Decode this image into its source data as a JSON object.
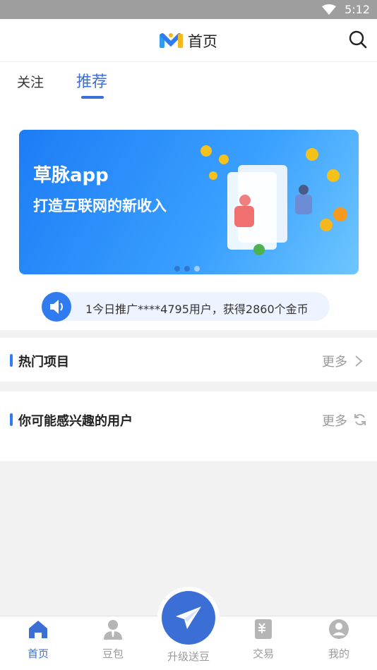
{
  "status_bar": {
    "time": "5:12"
  },
  "header": {
    "title": "首页"
  },
  "tabs": [
    {
      "label": "关注"
    },
    {
      "label": "推荐"
    }
  ],
  "banner": {
    "line1": "草脉app",
    "line2": "打造互联网的新收入"
  },
  "notice": {
    "text": "1今日推广****4795用户，获得2860个金币"
  },
  "sections": [
    {
      "title": "热门项目",
      "more": "更多"
    },
    {
      "title": "你可能感兴趣的用户",
      "more": "更多"
    }
  ],
  "bottom_nav": [
    {
      "label": "首页"
    },
    {
      "label": "豆包"
    },
    {
      "label": "升级送豆"
    },
    {
      "label": "交易"
    },
    {
      "label": "我的"
    }
  ],
  "colors": {
    "accent": "#3b6fd6",
    "notice_icon": "#2f7cf0"
  }
}
